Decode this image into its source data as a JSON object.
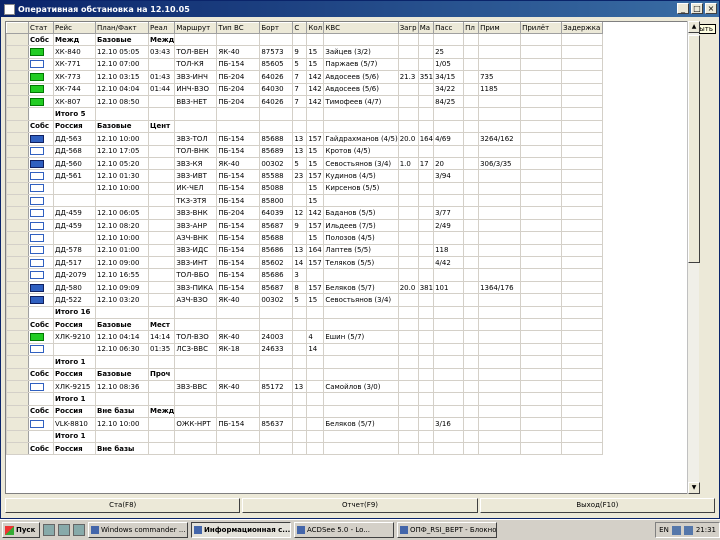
{
  "window": {
    "title": "Оперативная обстановка на 12.10.05",
    "tooltip": "Закрыть"
  },
  "grid": {
    "columns": [
      "",
      "Стат",
      "Рейс",
      "План/Факт",
      "Реал",
      "Маршрут",
      "Тип ВС",
      "Борт",
      "С",
      "Кол",
      "КВС",
      "Загр",
      "Ма",
      "Пасс",
      "Пл",
      "Прим",
      "Прилёт",
      "Задержка"
    ],
    "rows": [
      {
        "type": "group",
        "cells": [
          "",
          "Собс",
          "Межд",
          "Базовые",
          "Межд",
          "",
          "",
          "",
          "",
          "",
          "",
          "",
          "",
          "",
          "",
          "",
          "",
          ""
        ]
      },
      {
        "flag": "green",
        "cells": [
          "",
          "",
          "ХК-840",
          "12.10 05:05",
          "03:43",
          "ТОЛ-ВЕН",
          "ЯК-40",
          "87573",
          "9",
          "15",
          "Зайцев (3/2)",
          "",
          "",
          "25",
          "",
          "",
          "",
          ""
        ]
      },
      {
        "flag": "white",
        "cells": [
          "",
          "",
          "ХК-771",
          "12.10 07:00",
          "",
          "ТОЛ-КЯ",
          "ПБ-154",
          "85605",
          "5",
          "15",
          "Паржаев (5/7)",
          "",
          "",
          "1/05",
          "",
          "",
          "",
          ""
        ]
      },
      {
        "flag": "green",
        "cells": [
          "",
          "",
          "ХК-773",
          "12.10 03:15",
          "01:43",
          "ЗВЗ-ИНЧ",
          "ПБ-204",
          "64026",
          "7",
          "142",
          "Авдосеев (5/6)",
          "21.3",
          "351",
          "34/15",
          "",
          "735",
          "",
          ""
        ]
      },
      {
        "flag": "green",
        "cells": [
          "",
          "",
          "ХК-744",
          "12.10 04:04",
          "01:44",
          "ИНЧ-ВЗО",
          "ПБ-204",
          "64030",
          "7",
          "142",
          "Авдосеев (5/6)",
          "",
          "",
          "34/22",
          "",
          "1185",
          "",
          ""
        ]
      },
      {
        "flag": "green",
        "cells": [
          "",
          "",
          "ХК-807",
          "12.10 08:50",
          "",
          "ВВЗ-НЕТ",
          "ПБ-204",
          "64026",
          "7",
          "142",
          "Тимофеев (4/7)",
          "",
          "",
          "84/25",
          "",
          "",
          "",
          ""
        ]
      },
      {
        "type": "group",
        "cells": [
          "",
          "",
          "Итого 5",
          "",
          "",
          "",
          "",
          "",
          "",
          "",
          "",
          "",
          "",
          "",
          "",
          "",
          "",
          ""
        ]
      },
      {
        "type": "group",
        "cells": [
          "",
          "Собс",
          "Россия",
          "Базовые",
          "Цент",
          "",
          "",
          "",
          "",
          "",
          "",
          "",
          "",
          "",
          "",
          "",
          "",
          ""
        ]
      },
      {
        "flag": "blue",
        "cells": [
          "",
          "",
          "ДД-563",
          "12.10 10:00",
          "",
          "ЗВЗ-ТОЛ",
          "ПБ-154",
          "85688",
          "13",
          "157",
          "Гайдрахманов (4/5)",
          "20.0",
          "164",
          "4/69",
          "",
          "3264/162",
          "",
          ""
        ]
      },
      {
        "flag": "white",
        "cells": [
          "",
          "",
          "ДД-568",
          "12.10 17:05",
          "",
          "ТОЛ-ВНК",
          "ПБ-154",
          "85689",
          "13",
          "15",
          "Кротов (4/5)",
          "",
          "",
          "",
          "",
          "",
          "",
          ""
        ]
      },
      {
        "flag": "blue",
        "cells": [
          "",
          "",
          "ДД-560",
          "12.10 05:20",
          "",
          "ЗВЗ-КЯ",
          "ЯК-40",
          "00302",
          "5",
          "15",
          "Севостьянов (3/4)",
          "1.0",
          "17",
          "20",
          "",
          "306/3/35",
          "",
          ""
        ]
      },
      {
        "flag": "white",
        "cells": [
          "",
          "",
          "ДД-561",
          "12.10 01:30",
          "",
          "ЗВЗ-ИВТ",
          "ПБ-154",
          "85588",
          "23",
          "157",
          "Кудинов (4/5)",
          "",
          "",
          "3/94",
          "",
          "",
          "",
          ""
        ]
      },
      {
        "flag": "white",
        "cells": [
          "",
          "",
          "",
          "12.10 10:00",
          "",
          "ИК-ЧЕЛ",
          "ПБ-154",
          "85088",
          "",
          "15",
          "Кирсенов (5/5)",
          "",
          "",
          "",
          "",
          "",
          "",
          ""
        ]
      },
      {
        "flag": "white",
        "cells": [
          "",
          "",
          "",
          "",
          "",
          "ТКЗ-ЗТЯ",
          "ПБ-154",
          "85800",
          "",
          "15",
          "",
          "",
          "",
          "",
          "",
          "",
          "",
          ""
        ]
      },
      {
        "flag": "white",
        "cells": [
          "",
          "",
          "ДД-459",
          "12.10 06:05",
          "",
          "ЗВЗ-ВНК",
          "ПБ-204",
          "64039",
          "12",
          "142",
          "Баданов (5/5)",
          "",
          "",
          "3/77",
          "",
          "",
          "",
          ""
        ]
      },
      {
        "flag": "white",
        "cells": [
          "",
          "",
          "ДД-459",
          "12.10 08:20",
          "",
          "ЗВЗ-АНР",
          "ПБ-154",
          "85687",
          "9",
          "157",
          "Ильдеев (7/5)",
          "",
          "",
          "2/49",
          "",
          "",
          "",
          ""
        ]
      },
      {
        "flag": "white",
        "cells": [
          "",
          "",
          "",
          "12.10 10:00",
          "",
          "АЗЧ-ВНК",
          "ПБ-154",
          "85688",
          "",
          "15",
          "Полозов (4/5)",
          "",
          "",
          "",
          "",
          "",
          "",
          ""
        ]
      },
      {
        "flag": "white",
        "cells": [
          "",
          "",
          "ДД-578",
          "12.10 01:00",
          "",
          "ЗВЗ-ИДС",
          "ПБ-154",
          "85686",
          "13",
          "164",
          "Лаптев (5/5)",
          "",
          "",
          "118",
          "",
          "",
          "",
          ""
        ]
      },
      {
        "flag": "white",
        "cells": [
          "",
          "",
          "ДД-517",
          "12.10 09:00",
          "",
          "ЗВЗ-ИНТ",
          "ПБ-154",
          "85602",
          "14",
          "157",
          "Теляков (5/5)",
          "",
          "",
          "4/42",
          "",
          "",
          "",
          ""
        ]
      },
      {
        "flag": "white",
        "cells": [
          "",
          "",
          "ДД-2079",
          "12.10 16:55",
          "",
          "ТОЛ-ВБО",
          "ПБ-154",
          "85686",
          "3",
          "",
          "",
          "",
          "",
          "",
          "",
          "",
          "",
          ""
        ]
      },
      {
        "flag": "blue",
        "cells": [
          "",
          "",
          "ДД-580",
          "12.10 09:09",
          "",
          "ЗВЗ-ПИКА",
          "ПБ-154",
          "85687",
          "8",
          "157",
          "Беляков (5/7)",
          "20.0",
          "381",
          "101",
          "",
          "1364/176",
          "",
          ""
        ]
      },
      {
        "flag": "blue",
        "cells": [
          "",
          "",
          "ДД-522",
          "12.10 03:20",
          "",
          "АЗЧ-ВЗО",
          "ЯК-40",
          "00302",
          "5",
          "15",
          "Севостьянов (3/4)",
          "",
          "",
          "",
          "",
          "",
          "",
          ""
        ]
      },
      {
        "type": "group",
        "cells": [
          "",
          "",
          "Итого 16",
          "",
          "",
          "",
          "",
          "",
          "",
          "",
          "",
          "",
          "",
          "",
          "",
          "",
          "",
          ""
        ]
      },
      {
        "type": "group",
        "cells": [
          "",
          "Собс",
          "Россия",
          "Базовые",
          "Мест",
          "",
          "",
          "",
          "",
          "",
          "",
          "",
          "",
          "",
          "",
          "",
          "",
          ""
        ]
      },
      {
        "flag": "green",
        "cells": [
          "",
          "",
          "ХЛК-9210",
          "12.10 04:14",
          "14:14",
          "ТОЛ-ВЗО",
          "ЯК-40",
          "24003",
          "",
          "4",
          "Ешин (5/7)",
          "",
          "",
          "",
          "",
          "",
          "",
          ""
        ]
      },
      {
        "flag": "white",
        "cells": [
          "",
          "",
          "",
          "12.10 06:30",
          "01:35",
          "ЛСЗ-ВВС",
          "ЯК-18",
          "24633",
          "",
          "14",
          "",
          "",
          "",
          "",
          "",
          "",
          "",
          ""
        ]
      },
      {
        "type": "group",
        "cells": [
          "",
          "",
          "Итого 1",
          "",
          "",
          "",
          "",
          "",
          "",
          "",
          "",
          "",
          "",
          "",
          "",
          "",
          "",
          ""
        ]
      },
      {
        "type": "group",
        "cells": [
          "",
          "Собс",
          "Россия",
          "Базовые",
          "Проч",
          "",
          "",
          "",
          "",
          "",
          "",
          "",
          "",
          "",
          "",
          "",
          "",
          ""
        ]
      },
      {
        "flag": "white",
        "cells": [
          "",
          "",
          "ХЛК-9215",
          "12.10 08:36",
          "",
          "ЗВЗ-ВВС",
          "ЯК-40",
          "85172",
          "13",
          "",
          "Самойлов (3/0)",
          "",
          "",
          "",
          "",
          "",
          "",
          ""
        ]
      },
      {
        "type": "group",
        "cells": [
          "",
          "",
          "Итого 1",
          "",
          "",
          "",
          "",
          "",
          "",
          "",
          "",
          "",
          "",
          "",
          "",
          "",
          "",
          ""
        ]
      },
      {
        "type": "group",
        "cells": [
          "",
          "Собс",
          "Россия",
          "Вне базы",
          "Межд",
          "",
          "",
          "",
          "",
          "",
          "",
          "",
          "",
          "",
          "",
          "",
          "",
          ""
        ]
      },
      {
        "flag": "white",
        "cells": [
          "",
          "",
          "VLK-8810",
          "12.10 10:00",
          "",
          "ОЖК-НРТ",
          "ПБ-154",
          "85637",
          "",
          "",
          "Беляков (5/7)",
          "",
          "",
          "3/16",
          "",
          "",
          "",
          ""
        ]
      },
      {
        "type": "group",
        "cells": [
          "",
          "",
          "Итого 1",
          "",
          "",
          "",
          "",
          "",
          "",
          "",
          "",
          "",
          "",
          "",
          "",
          "",
          "",
          ""
        ]
      },
      {
        "type": "group",
        "cells": [
          "",
          "Собс",
          "Россия",
          "Вне базы",
          "",
          "",
          "",
          "",
          "",
          "",
          "",
          "",
          "",
          "",
          "",
          "",
          "",
          ""
        ]
      }
    ]
  },
  "buttons": {
    "stat": "Ста(F8)",
    "report": "Отчет(F9)",
    "exit": "Выход(F10)"
  },
  "taskbar": {
    "start": "Пуск",
    "tasks": [
      "Windows commander ...",
      "Информационная с...",
      "ACDSee 5.0 - Lo...",
      "ОПФ_RSI_ВЕРТ - Блокнот"
    ],
    "lang": "EN",
    "clock": "21:31"
  }
}
